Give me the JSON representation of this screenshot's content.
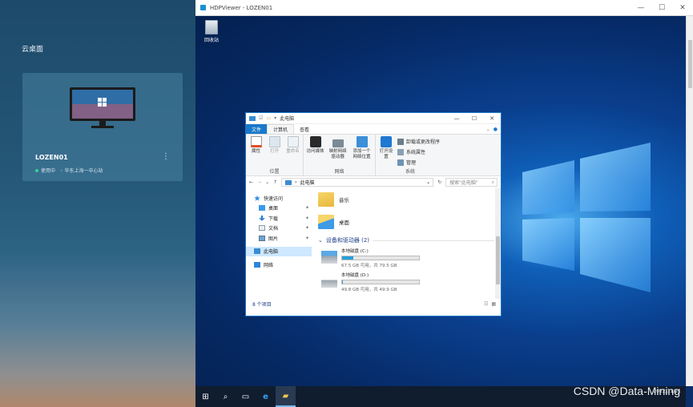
{
  "left_panel": {
    "title": "云桌面",
    "desktop_card": {
      "name": "LOZEN01",
      "status": "使用中",
      "location": "华东上海一中心站",
      "more": "⋮"
    }
  },
  "viewer": {
    "title": "HDPViewer - LOZEN01",
    "controls": {
      "minimize": "—",
      "maximize": "☐",
      "close": "✕"
    }
  },
  "desktop": {
    "recycle_bin_label": "回收站"
  },
  "explorer": {
    "title": "此电脑",
    "tabs": {
      "file": "文件",
      "computer": "计算机",
      "view": "查看"
    },
    "ribbon": {
      "location_group": {
        "label": "位置",
        "buttons": [
          "属性",
          "打开",
          "重命名"
        ]
      },
      "network_group": {
        "label": "网络",
        "buttons": [
          "访问媒体",
          "映射网络驱动器",
          "添加一个网络位置"
        ]
      },
      "system_group": {
        "label": "系统",
        "open_settings": "打开设置",
        "items": [
          "卸载或更改程序",
          "系统属性",
          "管理"
        ]
      }
    },
    "address": "此电脑",
    "search_placeholder": "搜索\"此电脑\"",
    "nav": {
      "quick_access": "快速访问",
      "desktop": "桌面",
      "downloads": "下载",
      "documents": "文档",
      "pictures": "图片",
      "this_pc": "此电脑",
      "network": "网络"
    },
    "folders": [
      "音乐",
      "桌面"
    ],
    "devices_header": "设备和驱动器 (2)",
    "drives": [
      {
        "name": "本地磁盘 (C:)",
        "free_text": "67.5 GB 可用，共 79.5 GB",
        "used_fraction": 0.15
      },
      {
        "name": "本地磁盘 (D:)",
        "free_text": "49.8 GB 可用，共 49.9 GB",
        "used_fraction": 0.002
      }
    ],
    "status": "8 个项目"
  },
  "taskbar": {
    "date": "2022/11/21"
  },
  "watermark": "CSDN @Data-Mining",
  "colors": {
    "accent": "#1979ca",
    "drive_fill": "#26a0da",
    "status_dot": "#37d39b"
  }
}
